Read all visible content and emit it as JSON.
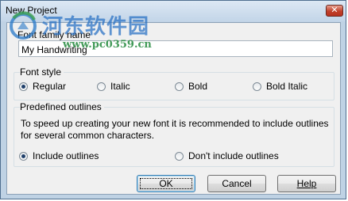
{
  "window": {
    "title": "New Project",
    "close_symbol": "✕"
  },
  "font_family": {
    "label": "Font family name",
    "value": "My Handwriting"
  },
  "font_style": {
    "legend": "Font style",
    "options": [
      {
        "label": "Regular",
        "selected": true
      },
      {
        "label": "Italic",
        "selected": false
      },
      {
        "label": "Bold",
        "selected": false
      },
      {
        "label": "Bold Italic",
        "selected": false
      }
    ]
  },
  "outlines": {
    "legend": "Predefined outlines",
    "description": "To speed up creating your new font it is recommended to include outlines for several common characters.",
    "options": [
      {
        "label": "Include outlines",
        "selected": true
      },
      {
        "label": "Don't include outlines",
        "selected": false
      }
    ]
  },
  "buttons": {
    "ok": "OK",
    "cancel": "Cancel",
    "help": "Help"
  },
  "watermark": {
    "title": "河东软件园",
    "url": "www.pc0359.cn"
  },
  "colors": {
    "titlebar": "#c3d5e8",
    "client_background": "#f0f0f0",
    "close_button": "#c0402a",
    "radio_dot": "#1f3f6a"
  }
}
